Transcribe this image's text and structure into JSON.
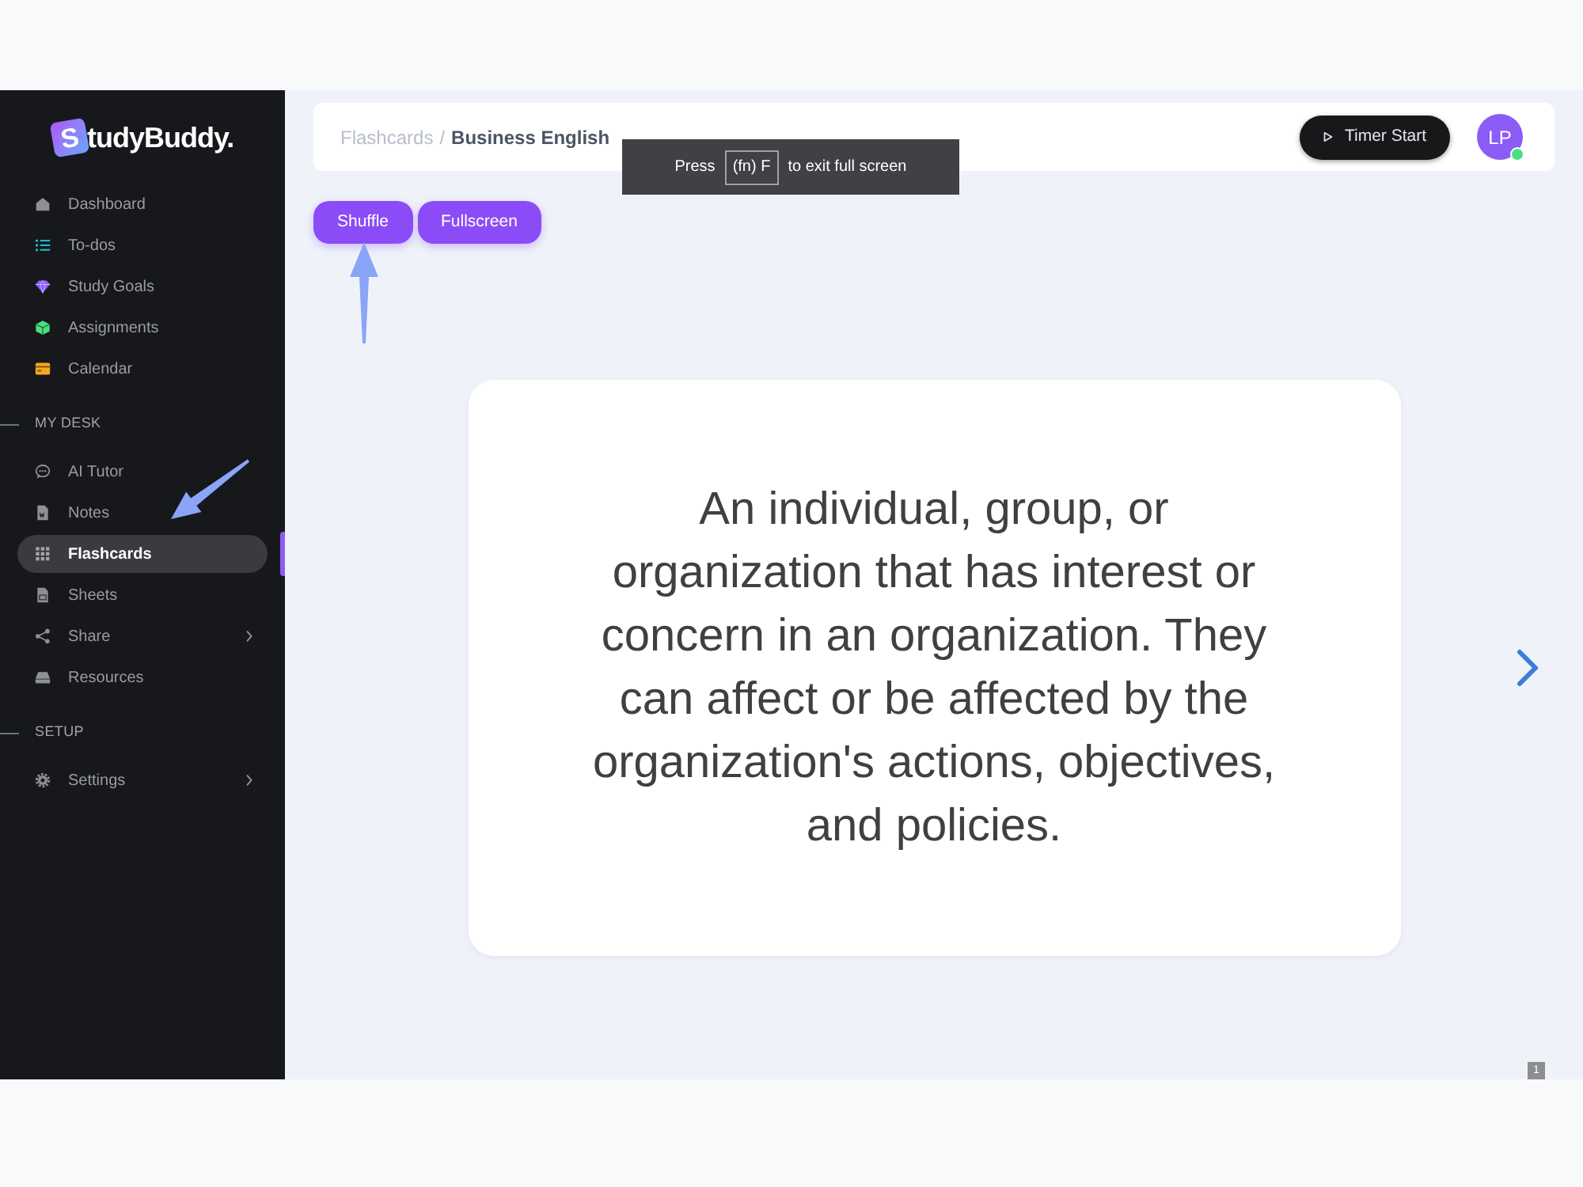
{
  "logo": {
    "initial": "S",
    "rest": "tudyBuddy."
  },
  "sidebar": {
    "groups": [
      {
        "items": [
          {
            "label": "Dashboard",
            "selected": false,
            "expandable": false
          },
          {
            "label": "To-dos",
            "selected": false,
            "expandable": false
          },
          {
            "label": "Study Goals",
            "selected": false,
            "expandable": false
          },
          {
            "label": "Assignments",
            "selected": false,
            "expandable": false
          },
          {
            "label": "Calendar",
            "selected": false,
            "expandable": false
          }
        ]
      },
      {
        "title": "MY DESK",
        "items": [
          {
            "label": "AI Tutor",
            "selected": false,
            "expandable": false
          },
          {
            "label": "Notes",
            "selected": false,
            "expandable": false
          },
          {
            "label": "Flashcards",
            "selected": true,
            "expandable": false
          },
          {
            "label": "Sheets",
            "selected": false,
            "expandable": false
          },
          {
            "label": "Share",
            "selected": false,
            "expandable": true
          },
          {
            "label": "Resources",
            "selected": false,
            "expandable": false
          }
        ]
      },
      {
        "title": "SETUP",
        "items": [
          {
            "label": "Settings",
            "selected": false,
            "expandable": true
          }
        ]
      }
    ]
  },
  "header": {
    "breadcrumb": [
      {
        "label": "Flashcards",
        "current": false
      },
      {
        "label": "Business English",
        "current": true
      }
    ],
    "separator": "/",
    "timer_button": "Timer Start",
    "avatar": {
      "initials": "LP",
      "online": true
    }
  },
  "fullscreen_hint": {
    "before": "Press",
    "key": "(fn) F",
    "after": "to exit full screen"
  },
  "actions": [
    "Shuffle",
    "Fullscreen"
  ],
  "flashcard": {
    "text": "An individual, group, or organization that has interest or concern in an organization. They can affect or be affected by the organization's actions, objectives, and policies."
  },
  "page_number": "1"
}
